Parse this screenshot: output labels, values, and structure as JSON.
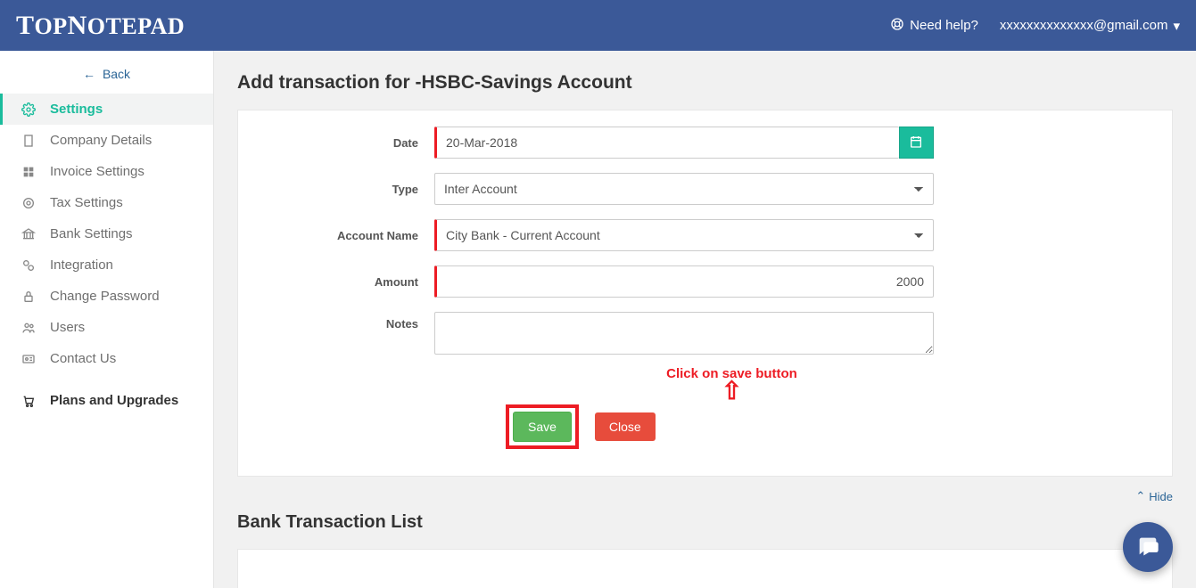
{
  "brand": "TopNotepad",
  "header": {
    "need_help": "Need help?",
    "user_email": "xxxxxxxxxxxxxx@gmail.com"
  },
  "sidebar": {
    "back": "Back",
    "settings": "Settings",
    "items": [
      {
        "label": "Company Details"
      },
      {
        "label": "Invoice Settings"
      },
      {
        "label": "Tax Settings"
      },
      {
        "label": "Bank Settings"
      },
      {
        "label": "Integration"
      },
      {
        "label": "Change Password"
      },
      {
        "label": "Users"
      },
      {
        "label": "Contact Us"
      }
    ],
    "plans": "Plans and Upgrades"
  },
  "page": {
    "title": "Add transaction for -HSBC-Savings Account",
    "form": {
      "date_label": "Date",
      "date_value": "20-Mar-2018",
      "type_label": "Type",
      "type_value": "Inter Account",
      "account_label": "Account Name",
      "account_value": "City Bank - Current Account",
      "amount_label": "Amount",
      "amount_value": "2000",
      "notes_label": "Notes",
      "notes_value": ""
    },
    "annotation": "Click on save button",
    "buttons": {
      "save": "Save",
      "close": "Close"
    },
    "list_title": "Bank Transaction List",
    "hide": "Hide"
  }
}
